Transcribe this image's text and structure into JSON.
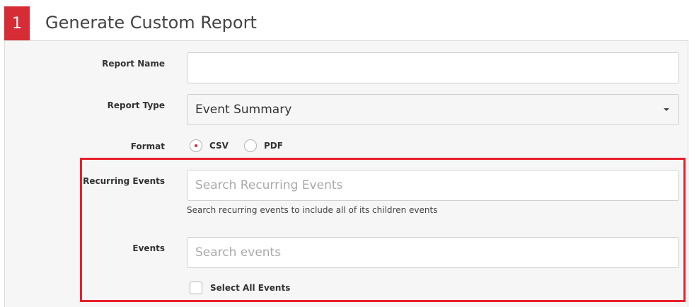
{
  "header": {
    "step_number": "1",
    "title": "Generate Custom Report"
  },
  "form": {
    "report_name": {
      "label": "Report Name",
      "value": "",
      "placeholder": ""
    },
    "report_type": {
      "label": "Report Type",
      "selected": "Event Summary"
    },
    "format": {
      "label": "Format",
      "options": [
        "CSV",
        "PDF"
      ],
      "selected": "CSV"
    },
    "recurring_events": {
      "label": "Recurring Events",
      "placeholder": "Search Recurring Events",
      "help": "Search recurring events to include all of its children events"
    },
    "events": {
      "label": "Events",
      "placeholder": "Search events"
    },
    "select_all": {
      "label": "Select All Events",
      "checked": false
    }
  },
  "colors": {
    "accent": "#d62c36",
    "highlight": "#e8202c",
    "panel_bg": "#f6f6f6"
  }
}
